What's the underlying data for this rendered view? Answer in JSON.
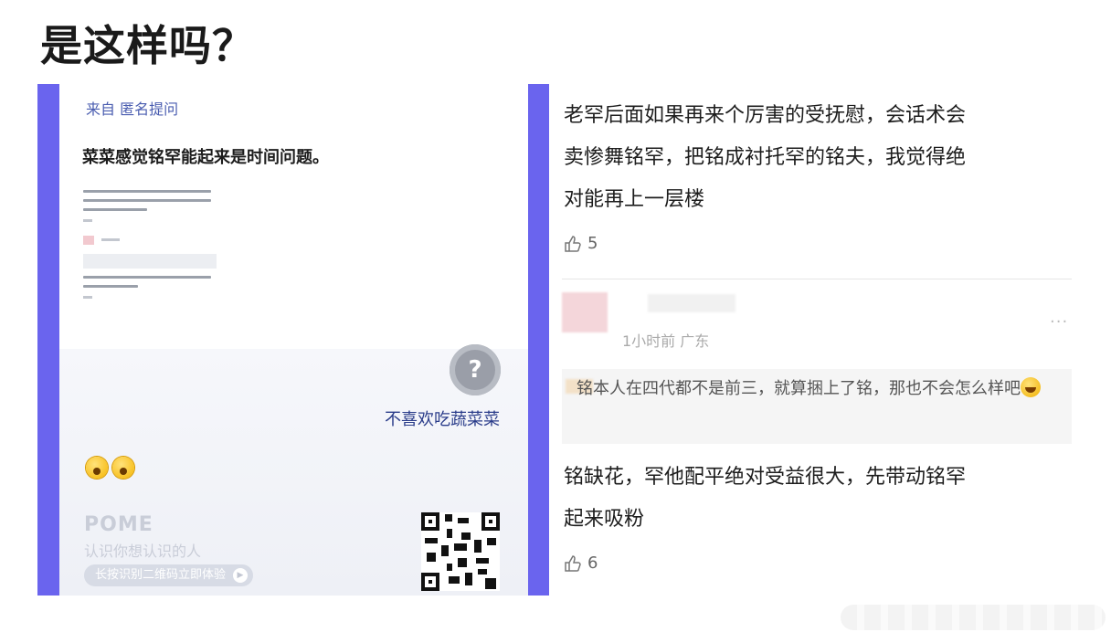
{
  "heading": "是这样吗？",
  "left_card": {
    "from_label": "来自",
    "from_value": "匿名提问",
    "question": "菜菜感觉铭罕能起来是时间问题。",
    "nickname": "不喜欢吃蔬菜菜",
    "avatar_glyph": "?",
    "emoji_count": 2,
    "brand": "POME",
    "slogan": "认识你想认识的人",
    "cta_label": "长按识别二维码立即体验",
    "accent_color": "#6a64ee"
  },
  "right_card": {
    "comment_1": {
      "line_1": "老罕后面如果再来个厉害的受抚慰，会话术会",
      "line_2": "卖惨舞铭罕，把铭成衬托罕的铭夫，我觉得绝",
      "line_3": "对能再上一层楼",
      "likes": "5"
    },
    "reply_meta": "1小时前 广东",
    "quote": "铭本人在四代都不是前三，就算捆上了铭，那也不会怎么样吧",
    "comment_2": {
      "line_1": "铭缺花，罕他配平绝对受益很大，先带动铭罕",
      "line_2": "起来吸粉",
      "likes": "6"
    },
    "more_label": "···"
  }
}
